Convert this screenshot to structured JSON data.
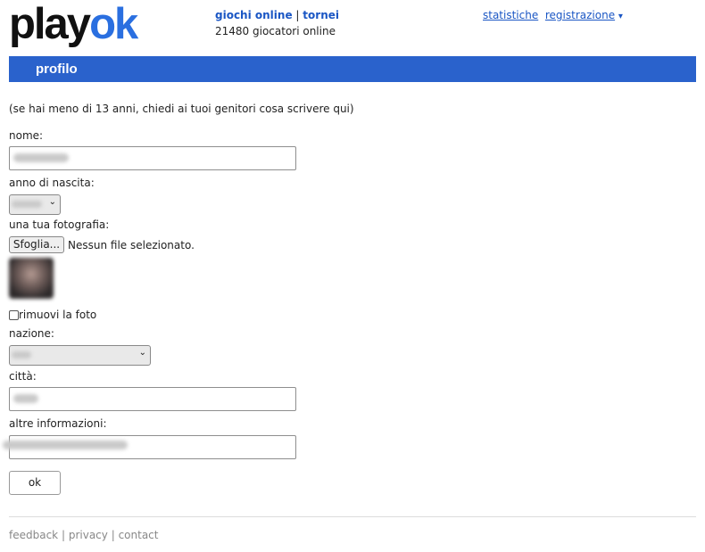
{
  "logo": {
    "part1": "play",
    "part2": "ok"
  },
  "topnav": {
    "games": "giochi online",
    "sep": "|",
    "tournaments": "tornei",
    "players_online": "21480 giocatori online"
  },
  "topright": {
    "stats": "statistiche",
    "register": "registrazione",
    "register_arrow": "▾"
  },
  "section_title": "profilo",
  "form": {
    "notice": "(se hai meno di 13 anni, chiedi ai tuoi genitori cosa scrivere qui)",
    "name_label": "nome:",
    "birth_year_label": "anno di nascita:",
    "photo_label": "una tua fotografia:",
    "browse_button": "Sfoglia...",
    "no_file": "Nessun file selezionato.",
    "remove_photo": "rimuovi la foto",
    "country_label": "nazione:",
    "city_label": "città:",
    "other_info_label": "altre informazioni:",
    "ok_button": "ok"
  },
  "footer": {
    "feedback": "feedback",
    "sep1": "|",
    "privacy": "privacy",
    "sep2": "|",
    "contact": "contact"
  }
}
